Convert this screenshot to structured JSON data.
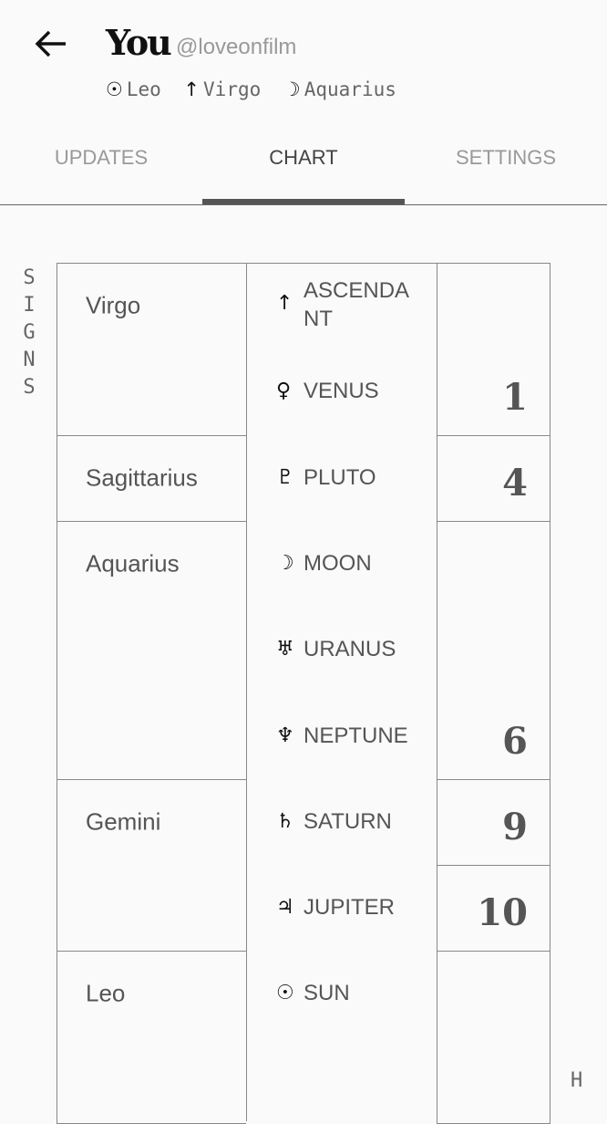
{
  "header": {
    "back_icon": "arrow-left-icon",
    "title": "You",
    "handle": "@loveonfilm",
    "big_three": [
      {
        "icon": "sun-icon",
        "glyph": "☉",
        "sign": "Leo"
      },
      {
        "icon": "ascendant-icon",
        "glyph": "↑",
        "sign": "Virgo"
      },
      {
        "icon": "moon-icon",
        "glyph": "☽",
        "sign": "Aquarius"
      }
    ]
  },
  "tabs": [
    {
      "label": "UPDATES",
      "active": false
    },
    {
      "label": "CHART",
      "active": true
    },
    {
      "label": "SETTINGS",
      "active": false
    }
  ],
  "chart": {
    "signs_label": "SIGNS",
    "houses_label": "H",
    "signs": [
      {
        "name": "Virgo",
        "rows": 2
      },
      {
        "name": "Sagittarius",
        "rows": 1
      },
      {
        "name": "Aquarius",
        "rows": 3
      },
      {
        "name": "Gemini",
        "rows": 2
      },
      {
        "name": "Leo",
        "rows": 2
      }
    ],
    "planets": [
      {
        "name": "ASCENDANT",
        "glyph": "↑",
        "icon": "ascendant-icon"
      },
      {
        "name": "VENUS",
        "glyph": "♀",
        "icon": "venus-icon"
      },
      {
        "name": "PLUTO",
        "glyph": "♇",
        "icon": "pluto-icon"
      },
      {
        "name": "MOON",
        "glyph": "☽",
        "icon": "moon-icon"
      },
      {
        "name": "URANUS",
        "glyph": "♅",
        "icon": "uranus-icon"
      },
      {
        "name": "NEPTUNE",
        "glyph": "♆",
        "icon": "neptune-icon"
      },
      {
        "name": "SATURN",
        "glyph": "♄",
        "icon": "saturn-icon"
      },
      {
        "name": "JUPITER",
        "glyph": "♃",
        "icon": "jupiter-icon"
      },
      {
        "name": "SUN",
        "glyph": "☉",
        "icon": "sun-icon"
      }
    ],
    "houses": [
      {
        "number": "1",
        "rows": 2
      },
      {
        "number": "4",
        "rows": 1
      },
      {
        "number": "6",
        "rows": 3
      },
      {
        "number": "9",
        "rows": 1
      },
      {
        "number": "10",
        "rows": 1
      },
      {
        "number": "",
        "rows": 2
      }
    ]
  }
}
